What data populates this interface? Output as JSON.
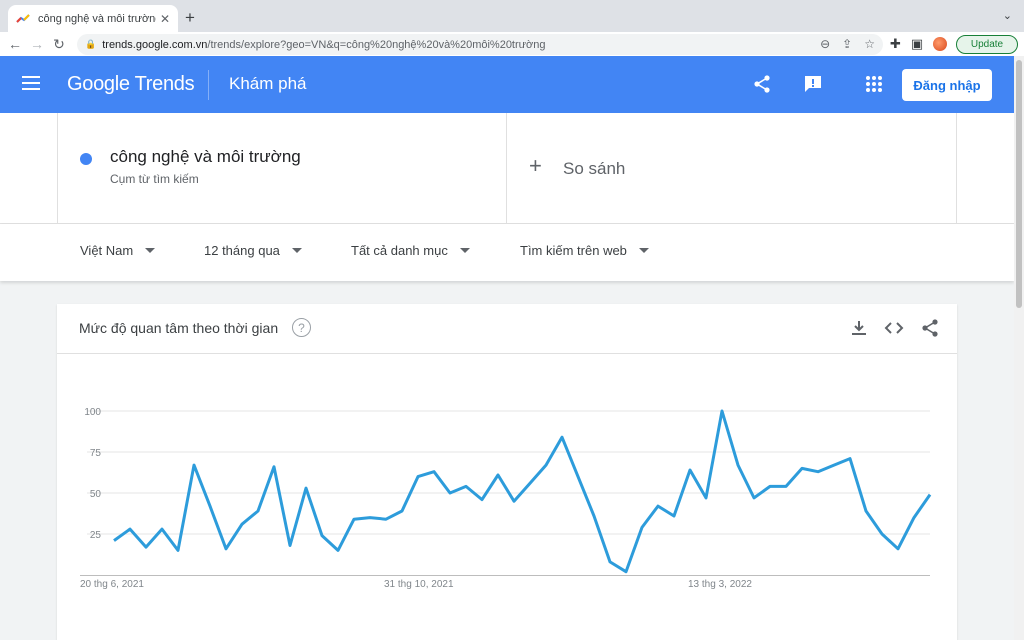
{
  "browser": {
    "tab_title": "công nghệ và môi trường - Khám phá",
    "new_tab": "+",
    "url_host": "trends.google.com.vn",
    "url_path": "/trends/explore?geo=VN&q=công%20nghệ%20và%20môi%20trường",
    "update_label": "Update"
  },
  "header": {
    "logo": "Google Trends",
    "page_name": "Khám phá",
    "signin_label": "Đăng nhập"
  },
  "search": {
    "term": "công nghệ và môi trường",
    "term_type": "Cụm từ tìm kiếm",
    "compare_label": "So sánh",
    "term_color": "#4285f4"
  },
  "filters": {
    "region": "Việt Nam",
    "period": "12 tháng qua",
    "category": "Tất cả danh mục",
    "search_type": "Tìm kiếm trên web"
  },
  "card": {
    "title": "Mức độ quan tâm theo thời gian",
    "help": "?"
  },
  "chart_data": {
    "type": "line",
    "title": "",
    "xlabel": "",
    "ylabel": "",
    "ylim": [
      0,
      100
    ],
    "yticks": [
      25,
      50,
      75,
      100
    ],
    "x_tick_labels": [
      "20 thg 6, 2021",
      "31 thg 10, 2021",
      "13 thg 3, 2022"
    ],
    "x_tick_index": [
      0,
      19,
      38
    ],
    "grid": true,
    "series": [
      {
        "color": "#2d9cdb",
        "values": [
          21,
          28,
          17,
          28,
          15,
          67,
          42,
          16,
          31,
          39,
          66,
          18,
          53,
          24,
          15,
          34,
          35,
          34,
          39,
          60,
          63,
          50,
          54,
          46,
          61,
          45,
          56,
          67,
          84,
          60,
          36,
          8,
          2,
          29,
          42,
          36,
          64,
          47,
          100,
          67,
          47,
          54,
          54,
          65,
          63,
          67,
          71,
          39,
          25,
          16,
          35,
          49
        ]
      }
    ]
  }
}
